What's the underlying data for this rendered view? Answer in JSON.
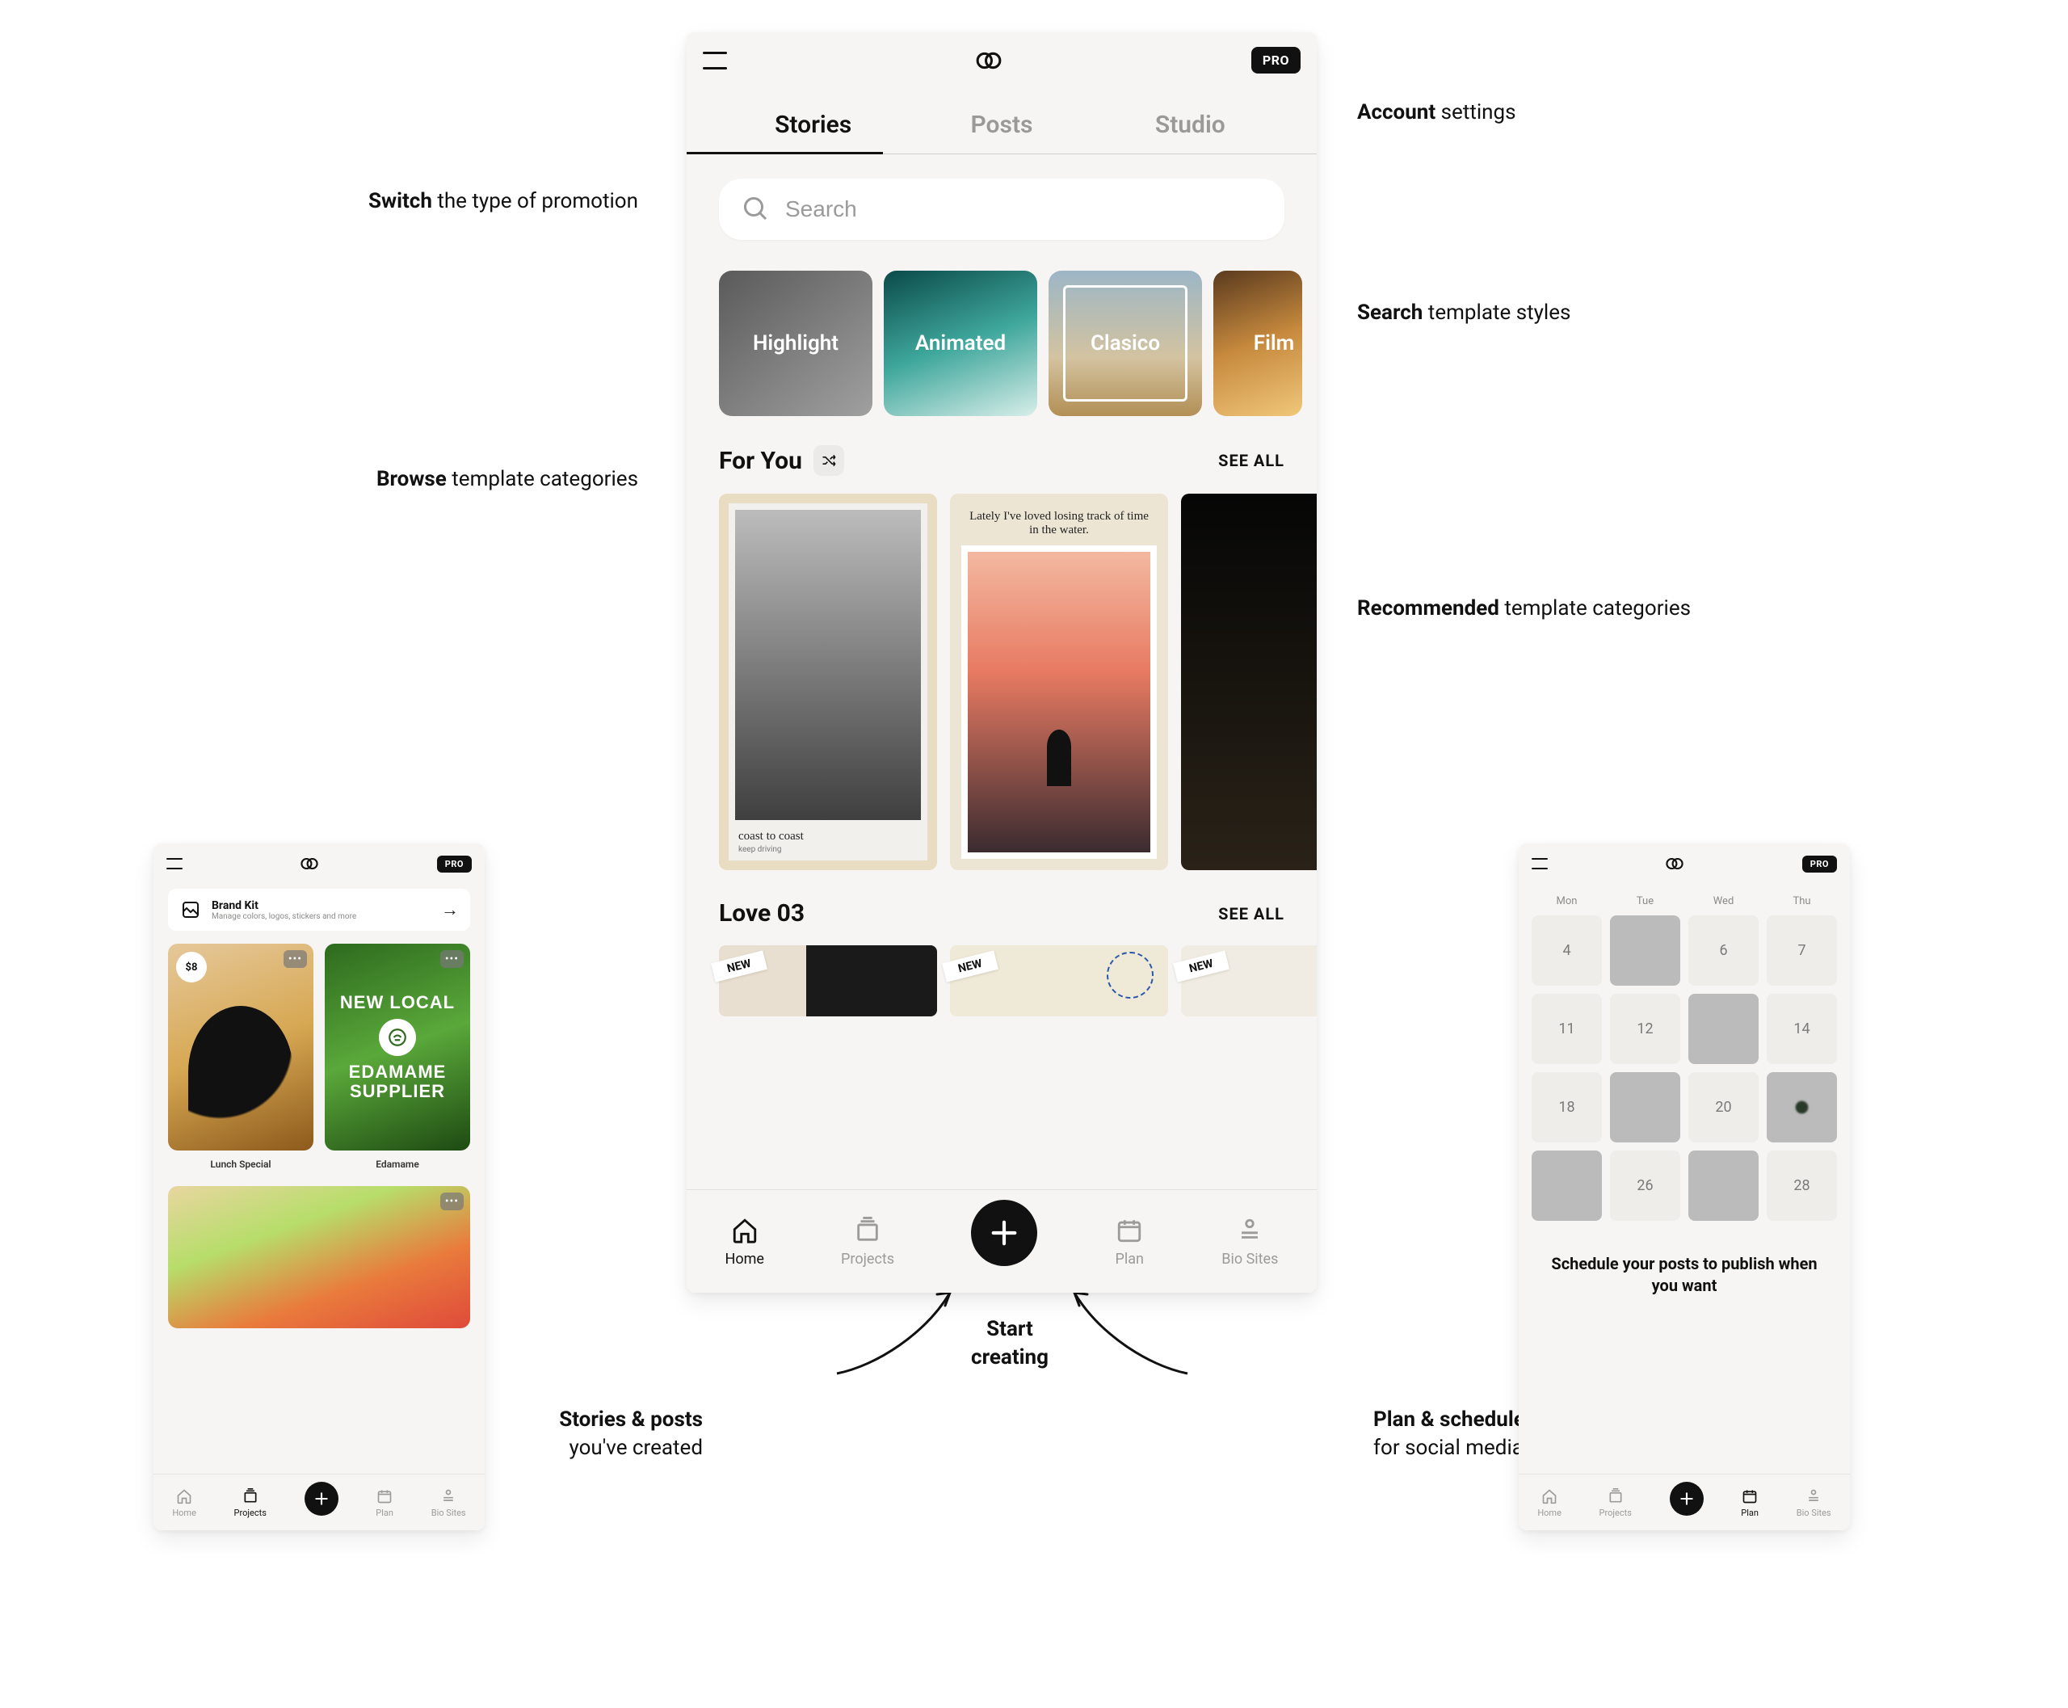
{
  "annotations": {
    "switch": {
      "bold": "Switch",
      "rest": " the type of promotion"
    },
    "account": {
      "bold": "Account",
      "rest": " settings"
    },
    "search": {
      "bold": "Search",
      "rest": " template styles"
    },
    "browse": {
      "bold": "Browse",
      "rest": " template categories"
    },
    "recommended": {
      "bold": "Recommended",
      "rest": " template categories"
    },
    "start": {
      "line1": "Start",
      "line2": "creating"
    },
    "stories": {
      "bold": "Stories & posts",
      "rest": "you've created"
    },
    "plan": {
      "bold": "Plan & schedule",
      "rest": "for social media"
    }
  },
  "common": {
    "pro_badge": "PRO",
    "tabbar": [
      "Home",
      "Projects",
      "Plan",
      "Bio Sites"
    ]
  },
  "center": {
    "tabs": [
      "Stories",
      "Posts",
      "Studio"
    ],
    "active_tab_index": 0,
    "search_placeholder": "Search",
    "categories": [
      "Highlight",
      "Animated",
      "Clasico",
      "Film"
    ],
    "sections": {
      "foryou": {
        "title": "For You",
        "see_all": "SEE ALL",
        "card1": {
          "caption1": "coast to coast",
          "caption2": "keep driving"
        },
        "card2": {
          "script": "Lately I've loved losing track of time in the water."
        }
      },
      "love": {
        "title": "Love 03",
        "see_all": "SEE ALL",
        "new_label": "NEW"
      }
    },
    "active_nav": "Home"
  },
  "left": {
    "brandkit": {
      "title": "Brand Kit",
      "subtitle": "Manage colors, logos, stickers and more"
    },
    "projects": [
      {
        "label": "Lunch Special",
        "price": "$8"
      },
      {
        "label": "Edamame",
        "overlay_top": "NEW LOCAL",
        "overlay_bottom": "EDAMAME SUPPLIER"
      }
    ],
    "active_nav": "Projects"
  },
  "right": {
    "day_headers": [
      "Mon",
      "Tue",
      "Wed",
      "Thu"
    ],
    "cells": [
      {
        "t": "num",
        "v": "4"
      },
      {
        "t": "img",
        "c": "ci1"
      },
      {
        "t": "num",
        "v": "6"
      },
      {
        "t": "num",
        "v": "7"
      },
      {
        "t": "num",
        "v": "11"
      },
      {
        "t": "num",
        "v": "12"
      },
      {
        "t": "img",
        "c": "ci3"
      },
      {
        "t": "num",
        "v": "14"
      },
      {
        "t": "num",
        "v": "18"
      },
      {
        "t": "img",
        "c": "ci4"
      },
      {
        "t": "num",
        "v": "20"
      },
      {
        "t": "img",
        "c": "ci7"
      },
      {
        "t": "img",
        "c": "ci5"
      },
      {
        "t": "num",
        "v": "26"
      },
      {
        "t": "img",
        "c": "ci6"
      },
      {
        "t": "num",
        "v": "28"
      }
    ],
    "schedule_text": "Schedule your posts to publish when you want",
    "active_nav": "Plan"
  }
}
